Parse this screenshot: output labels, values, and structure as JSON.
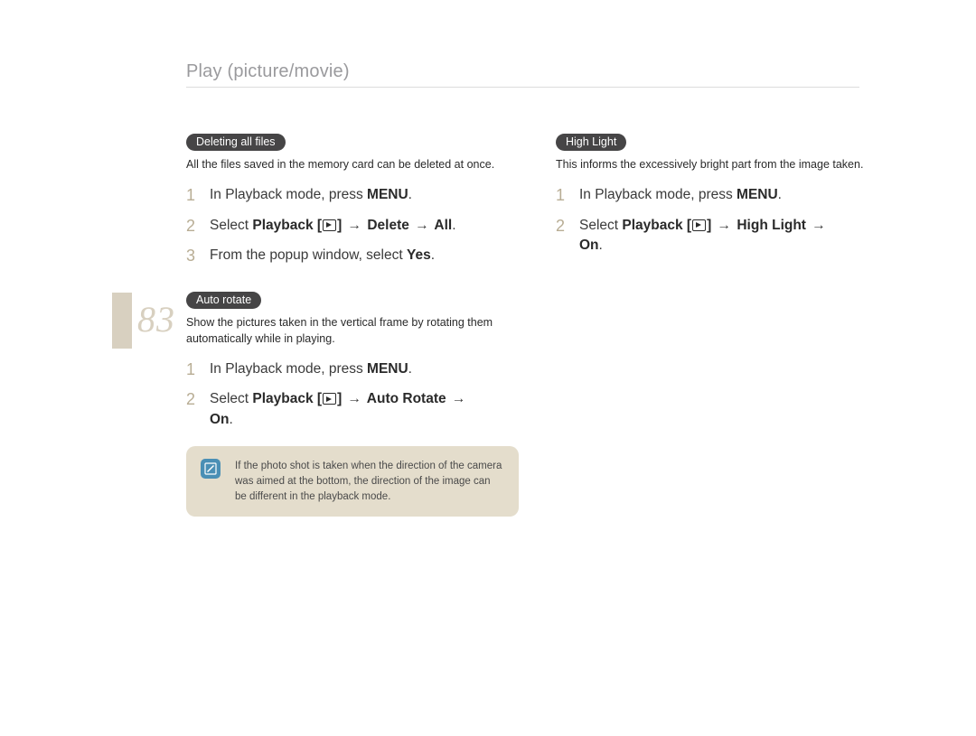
{
  "header": {
    "title": "Play (picture/movie)"
  },
  "page_number": "83",
  "left": {
    "section1": {
      "pill": "Deleting all files",
      "desc": "All the files saved in the memory card can be deleted at once.",
      "steps": [
        {
          "num": "1",
          "prefix": "In Playback mode, press ",
          "b1": "MENU",
          "suffix": "."
        },
        {
          "num": "2",
          "prefix": "Select ",
          "b1": "Playback",
          "mid1": " [",
          "icon": true,
          "mid2": "] ",
          "arrow1": "→",
          "b2": " Delete ",
          "arrow2": "→",
          "b3": " All",
          "suffix": "."
        },
        {
          "num": "3",
          "prefix": "From the popup window, select ",
          "b1": "Yes",
          "suffix": "."
        }
      ]
    },
    "section2": {
      "pill": "Auto rotate",
      "desc": "Show the pictures taken in the vertical frame by rotating them automatically while in playing.",
      "steps": [
        {
          "num": "1",
          "prefix": "In Playback mode, press ",
          "b1": "MENU",
          "suffix": "."
        },
        {
          "num": "2",
          "prefix": "Select ",
          "b1": "Playback",
          "mid1": " [",
          "icon": true,
          "mid2": "] ",
          "arrow1": "→",
          "b2": " Auto Rotate ",
          "arrow2": "→",
          "b3_line2": "On",
          "suffix": "."
        }
      ]
    },
    "note": "If the photo shot is taken when the direction of the camera was aimed at the bottom, the direction of the image can be different in the playback mode."
  },
  "right": {
    "section1": {
      "pill": "High Light",
      "desc": "This informs the excessively bright part from the image taken.",
      "steps": [
        {
          "num": "1",
          "prefix": "In Playback mode, press ",
          "b1": "MENU",
          "suffix": "."
        },
        {
          "num": "2",
          "prefix": "Select ",
          "b1": "Playback",
          "mid1": " [",
          "icon": true,
          "mid2": "] ",
          "arrow1": "→",
          "b2": " High Light ",
          "arrow2": "→",
          "b3_line2": "On",
          "suffix": "."
        }
      ]
    }
  }
}
